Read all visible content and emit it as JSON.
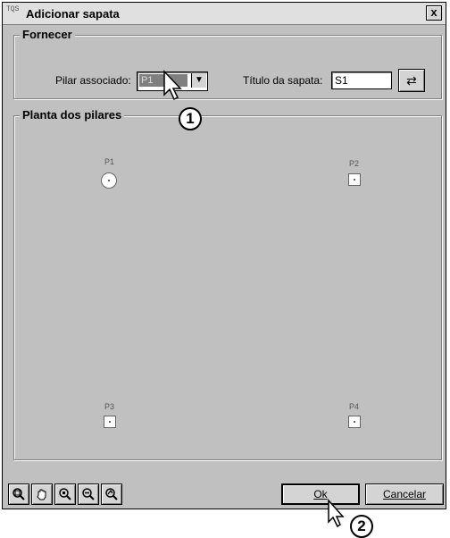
{
  "window": {
    "icon_text": "TQS",
    "title": "Adicionar sapata",
    "close_label": "x"
  },
  "fornecer": {
    "label": "Fornecer",
    "pilar_label": "Pilar associado:",
    "pilar_value": "P1",
    "titulo_label": "Título da sapata:",
    "titulo_value": "S1"
  },
  "planta": {
    "label": "Planta dos pilares",
    "pilares": [
      {
        "name": "P1",
        "shape": "circle"
      },
      {
        "name": "P2",
        "shape": "square"
      },
      {
        "name": "P3",
        "shape": "square"
      },
      {
        "name": "P4",
        "shape": "square"
      }
    ]
  },
  "toolbar": {
    "tools": [
      "zoom-window-icon",
      "pan-hand-icon",
      "zoom-extents-icon",
      "zoom-out-icon",
      "zoom-previous-icon"
    ]
  },
  "buttons": {
    "ok_label": "Ok",
    "cancel_label": "Cancelar"
  },
  "callouts": [
    "1",
    "2"
  ]
}
